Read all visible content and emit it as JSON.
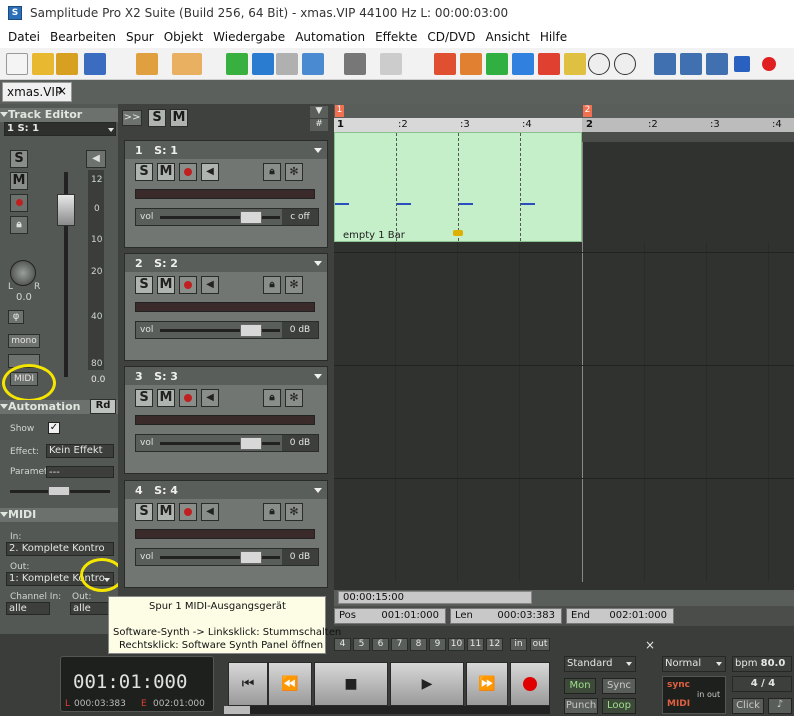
{
  "window": {
    "title": "Samplitude Pro X2 Suite (Build 256, 64 Bit)  -  xmas.VIP  44100 Hz L: 00:00:03:00"
  },
  "menu": [
    "Datei",
    "Bearbeiten",
    "Spur",
    "Objekt",
    "Wiedergabe",
    "Automation",
    "Effekte",
    "CD/DVD",
    "Ansicht",
    "Hilfe"
  ],
  "tab": {
    "label": "xmas.VIP",
    "close": "×"
  },
  "track_editor": {
    "header": "Track Editor",
    "track_select": "1    S: 1",
    "solo": "S",
    "mute": "M",
    "pan_value": "0.0",
    "pan_l": "L",
    "pan_r": "R",
    "phase": "φ",
    "mono": "mono",
    "midi": "MIDI",
    "meter_scale": [
      "12",
      "0",
      "10",
      "20",
      "40",
      "80"
    ],
    "fader_value": "0.0"
  },
  "automation": {
    "header": "Automation",
    "rd": "Rd",
    "show_label": "Show",
    "effect_label": "Effect:",
    "effect_value": "Kein Effekt",
    "parameter_label": "Parameter",
    "parameter_value": "---"
  },
  "midi_section": {
    "header": "MIDI",
    "in_label": "In:",
    "in_value": "2. Komplete Kontro",
    "out_label": "Out:",
    "out_value": "1: Komplete Kontro",
    "channel_in_label": "Channel In:",
    "channel_in_value": "alle",
    "channel_out_label": "Out:",
    "channel_out_value": "alle"
  },
  "track_list_header": {
    "expand": ">>",
    "solo": "S",
    "mute": "M"
  },
  "tracks": [
    {
      "num": "1",
      "name": "S: 1",
      "vol_label": "vol",
      "vol_value": "c off"
    },
    {
      "num": "2",
      "name": "S: 2",
      "vol_label": "vol",
      "vol_value": "0 dB"
    },
    {
      "num": "3",
      "name": "S: 3",
      "vol_label": "vol",
      "vol_value": "0 dB"
    },
    {
      "num": "4",
      "name": "S: 4",
      "vol_label": "vol",
      "vol_value": "0 dB"
    }
  ],
  "ruler": {
    "markers": [
      "1",
      "2"
    ],
    "beats": [
      "1",
      ":2",
      ":3",
      ":4",
      "2",
      ":2",
      ":3",
      ":4"
    ]
  },
  "region": {
    "label": "empty 1 Bar"
  },
  "timeline": {
    "scroll_time": "00:00:15:00"
  },
  "position": {
    "pos_label": "Pos",
    "pos_value": "001:01:000",
    "len_label": "Len",
    "len_value": "000:03:383",
    "end_label": "End",
    "end_value": "002:01:000"
  },
  "tooltip": {
    "line1": "Spur 1  MIDI-Ausgangsgerät",
    "line2": "Software-Synth -> Linksklick: Stummschalten",
    "line3": "Rechtsklick: Software Synth Panel öffnen"
  },
  "transport": {
    "counter": "001:01:000",
    "l_label": "L",
    "l_value": "000:03:383",
    "e_label": "E",
    "e_value": "002:01:000",
    "numbers": [
      "4",
      "5",
      "6",
      "7",
      "8",
      "9",
      "10",
      "11",
      "12"
    ],
    "in": "in",
    "out": "out",
    "mode": "Standard",
    "mon": "Mon",
    "sync": "Sync",
    "punch": "Punch",
    "loop": "Loop",
    "normal": "Normal",
    "bpm_label": "bpm",
    "bpm_value": "80.0",
    "timesig": "4 / 4",
    "sync_label": "sync",
    "midi_label": "MIDI",
    "io_in": "in",
    "io_out": "out",
    "click": "Click"
  },
  "colors": {
    "region": "#c4efc9",
    "record": "#e00000",
    "highlight": "#f5e600"
  }
}
